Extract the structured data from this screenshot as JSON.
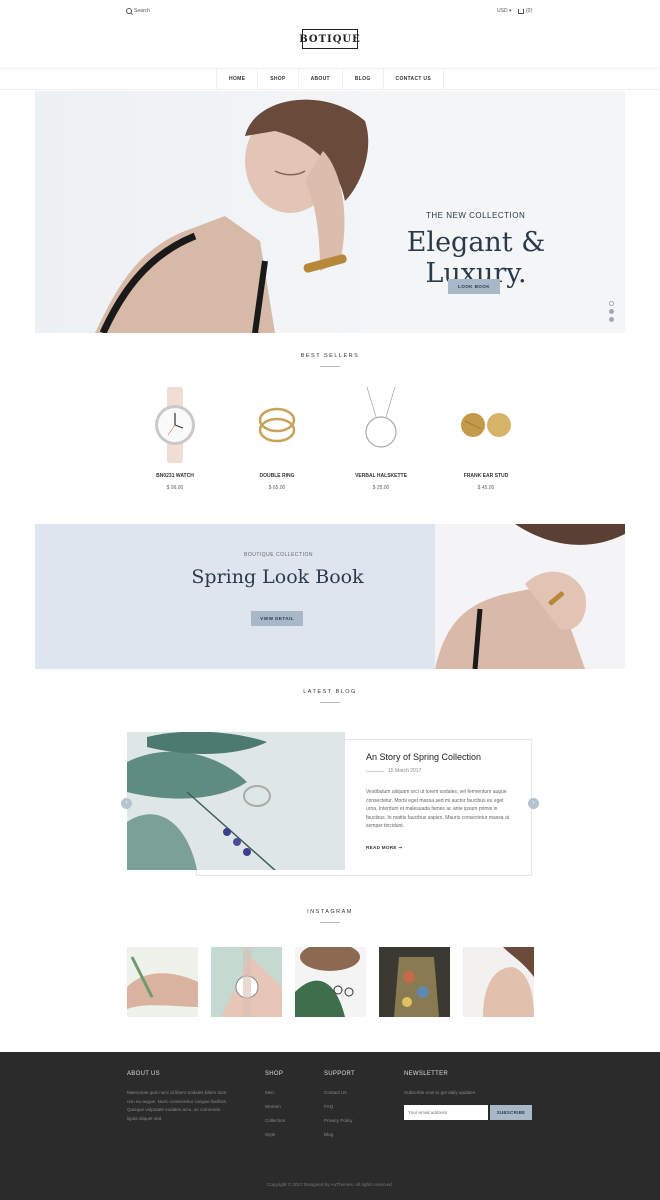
{
  "header": {
    "search_label": "Search",
    "currency": "USD ▾",
    "cart_count": "(0)",
    "logo": "BOTIQUE"
  },
  "nav": [
    "HOME",
    "SHOP",
    "ABOUT",
    "BLOG",
    "CONTACT US"
  ],
  "hero": {
    "subtitle": "THE NEW COLLECTION",
    "title": "Elegant & Luxury.",
    "button": "LOOK BOOK"
  },
  "best_sellers": {
    "title": "BEST SELLERS",
    "products": [
      {
        "name": "BN0231 WATCH",
        "price": "$ 99.00"
      },
      {
        "name": "DOUBLE RING",
        "price": "$ 65.00"
      },
      {
        "name": "VERBAL HALSKETTE",
        "price": "$ 25.00"
      },
      {
        "name": "FRANK EAR STUD",
        "price": "$ 45.00"
      }
    ]
  },
  "lookbook": {
    "subtitle": "BOUTIQUE COLLECTION",
    "title": "Spring Look Book",
    "button": "VIEW DETAIL"
  },
  "blog": {
    "title": "LATEST BLOG",
    "post_title": "An Story of Spring Collection",
    "date": "15 March 2017",
    "excerpt": "Vestibulum aliquam orci ut lorem sodales, vel fermentum augue consectetur. Morbi eget massa sed mi auctor faucibus eu eget urna. Interdum et malesuada fames ac ante ipsum primis in faucibus. In mattis faucibus sapien. Mauris consectetur massa at semper tincidunt.",
    "read_more": "READ MORE ➞"
  },
  "instagram": {
    "title": "INSTAGRAM"
  },
  "footer": {
    "about_title": "ABOUT US",
    "about_text": "Maecenas quis nunc id libero sodales biben dum non eu augue. Nunc consectetur congue facilisis. Quisque vulputate sodales arcu, ac commodo ligula aliquet sed.",
    "shop_title": "SHOP",
    "shop_links": [
      "Men",
      "Women",
      "Collection",
      "Style"
    ],
    "support_title": "SUPPORT",
    "support_links": [
      "Contact Us",
      "FAQ",
      "Privacy Policy",
      "Blog"
    ],
    "newsletter_title": "NEWSLETTER",
    "newsletter_text": "Subscribe now to get daily updates",
    "email_placeholder": "Your email address",
    "subscribe": "SUBSCRIBE",
    "copyright": "Copyright © 2017 Designed by AuThemes. All rights reserved."
  },
  "colors": {
    "accent": "#a9b8c6",
    "dark_text": "#2b3a4a",
    "footer_bg": "#2b2b2b"
  }
}
